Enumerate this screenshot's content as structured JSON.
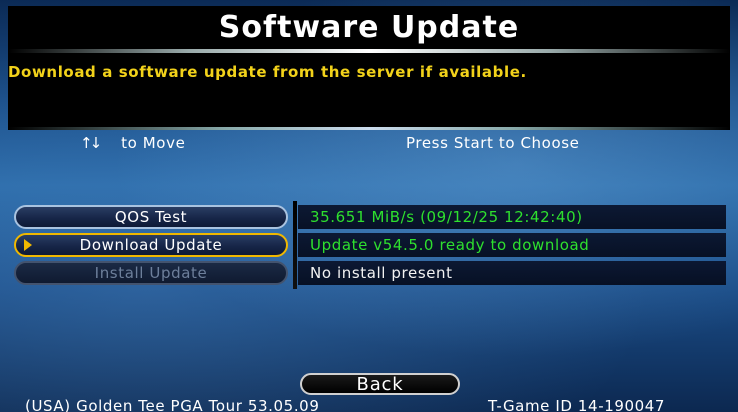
{
  "header": {
    "title": "Software Update",
    "description": "Download a software update from the server if available."
  },
  "hints": {
    "move_icon": "up-down-arrows",
    "move_arrows": "↑↓",
    "move_label": "to Move",
    "choose_label": "Press Start to Choose"
  },
  "menu": {
    "items": [
      {
        "label": "QOS Test",
        "status": "35.651 MiB/s (09/12/25 12:42:40)",
        "status_color": "#2ee02e",
        "enabled": true,
        "selected": false
      },
      {
        "label": "Download Update",
        "status": "Update v54.5.0 ready to download",
        "status_color": "#2ee02e",
        "enabled": true,
        "selected": true
      },
      {
        "label": "Install Update",
        "status": "No install present",
        "status_color": "#f2f2f2",
        "enabled": false,
        "selected": false
      }
    ]
  },
  "back_label": "Back",
  "footer": {
    "left": "(USA) Golden Tee PGA Tour 53.05.09",
    "right": "T-Game ID 14-190047"
  },
  "colors": {
    "accent_yellow": "#f2d21a",
    "selection_gold": "#f0b800",
    "status_green": "#2ee02e"
  }
}
